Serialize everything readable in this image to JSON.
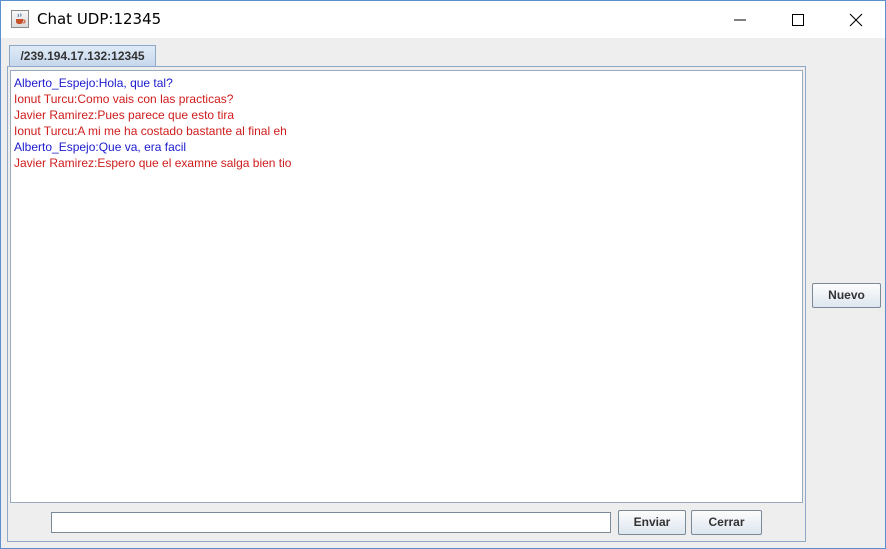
{
  "window": {
    "title": "Chat UDP:12345",
    "icon": "java-cup-icon",
    "controls": [
      "minimize-icon",
      "maximize-icon",
      "close-icon"
    ]
  },
  "tabs": [
    {
      "label": "/239.194.17.132:12345",
      "selected": true
    }
  ],
  "messages": [
    {
      "text": "Alberto_Espejo:Hola, que tal?",
      "color": "#1b1bcf"
    },
    {
      "text": "Ionut Turcu:Como vais con las practicas?",
      "color": "#d01c1c"
    },
    {
      "text": "Javier Ramirez:Pues parece que esto tira",
      "color": "#d01c1c"
    },
    {
      "text": "Ionut Turcu:A mi me ha costado bastante al final eh",
      "color": "#d01c1c"
    },
    {
      "text": "Alberto_Espejo:Que va, era facil",
      "color": "#1b1bcf"
    },
    {
      "text": "Javier Ramirez:Espero que el examne salga bien tio",
      "color": "#d01c1c"
    }
  ],
  "input": {
    "value": ""
  },
  "buttons": {
    "send": "Enviar",
    "close": "Cerrar",
    "new": "Nuevo"
  }
}
